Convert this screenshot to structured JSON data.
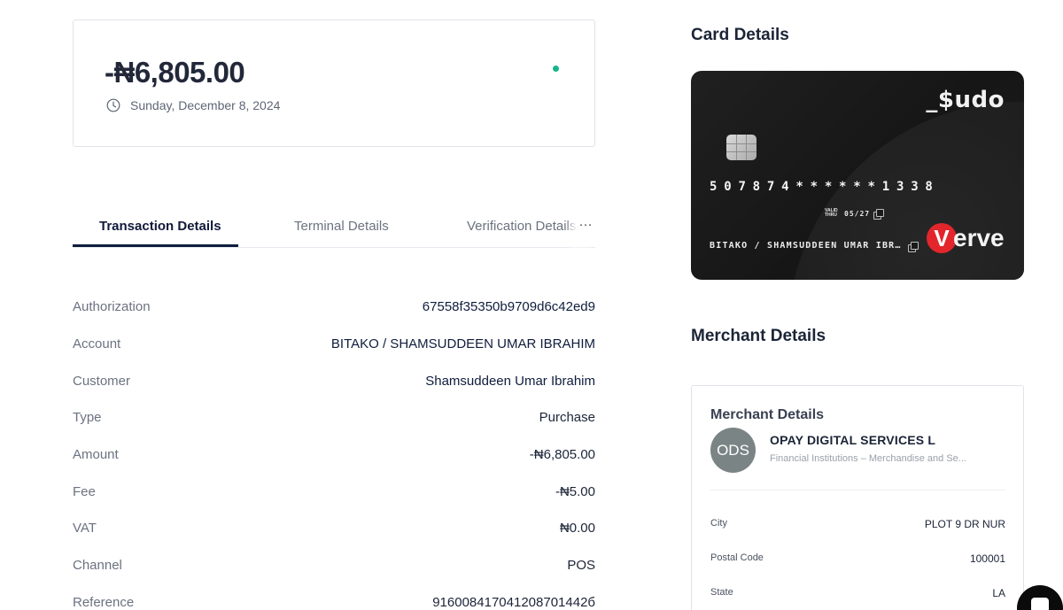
{
  "summary": {
    "amount": "-₦6,805.00",
    "date": "Sunday, December 8, 2024",
    "icons": {
      "clock": "clock-icon",
      "status": "status-dot"
    },
    "colors": {
      "status_dot": "#16b58b"
    }
  },
  "tabs": [
    {
      "label": "Transaction Details",
      "active": true
    },
    {
      "label": "Terminal Details",
      "active": false
    },
    {
      "label": "Verification Details",
      "active": false
    }
  ],
  "tabs_more": "···",
  "transaction": [
    {
      "label": "Authorization",
      "value": "67558f35350b9709d6c42ed9"
    },
    {
      "label": "Account",
      "value": "BITAKO / SHAMSUDDEEN UMAR IBRAHIM"
    },
    {
      "label": "Customer",
      "value": "Shamsuddeen Umar Ibrahim"
    },
    {
      "label": "Type",
      "value": "Purchase"
    },
    {
      "label": "Amount",
      "value": "-₦6,805.00"
    },
    {
      "label": "Fee",
      "value": "-₦5.00"
    },
    {
      "label": "VAT",
      "value": "₦0.00"
    },
    {
      "label": "Channel",
      "value": "POS"
    },
    {
      "label": "Reference",
      "value": "916008417041208701442б"
    }
  ],
  "card_section": {
    "title": "Card Details",
    "brand": "_$udo",
    "pan": "507874******1338",
    "valid_label": "VALID THRU",
    "valid_date": "05/27",
    "holder": "BITAKO / SHAMSUDDEEN UMAR IBR…",
    "network_mark": "V",
    "network_text": "erve",
    "colors": {
      "card_bg": "#1a1a1a",
      "verve_red": "#e3262b"
    }
  },
  "merchant_section": {
    "title": "Merchant Details",
    "box_title": "Merchant Details",
    "initials": "ODS",
    "name": "OPAY DIGITAL SERVICES L",
    "category": "Financial Institutions – Merchandise and Se...",
    "rows": [
      {
        "label": "City",
        "value": "PLOT 9 DR NUR"
      },
      {
        "label": "Postal Code",
        "value": "100001"
      },
      {
        "label": "State",
        "value": "LA"
      }
    ]
  }
}
